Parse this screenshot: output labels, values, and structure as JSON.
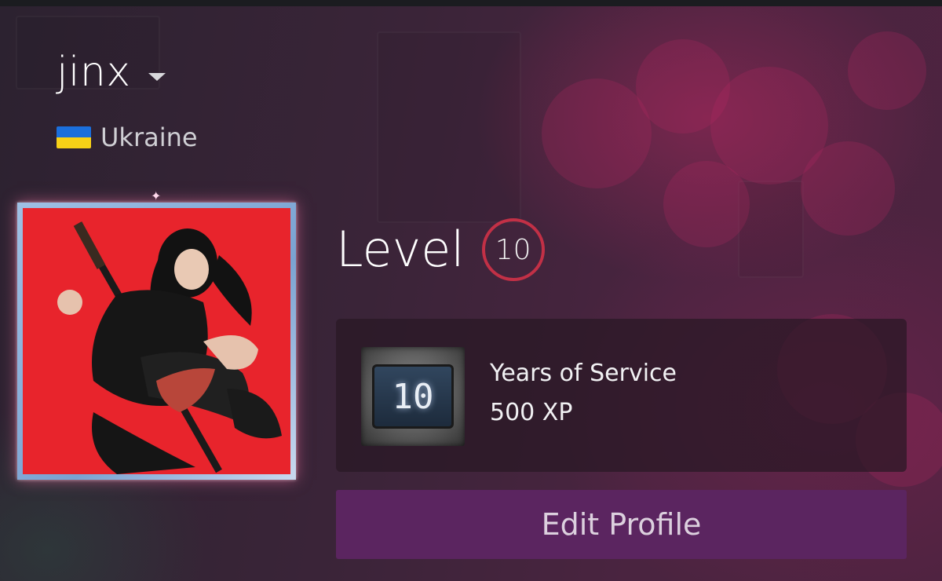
{
  "profile": {
    "username": "jinx",
    "country": "Ukraine"
  },
  "level": {
    "label": "Level",
    "value": "10"
  },
  "badge": {
    "icon_text": "10",
    "title": "Years of Service",
    "xp": "500 XP"
  },
  "actions": {
    "edit_profile_label": "Edit Profile"
  },
  "colors": {
    "level_ring": "#c23046",
    "edit_button_bg": "#5b2560",
    "avatar_bg": "#e8242c"
  },
  "icons": {
    "dropdown": "chevron-down-icon",
    "flag": "ukraine-flag-icon"
  }
}
